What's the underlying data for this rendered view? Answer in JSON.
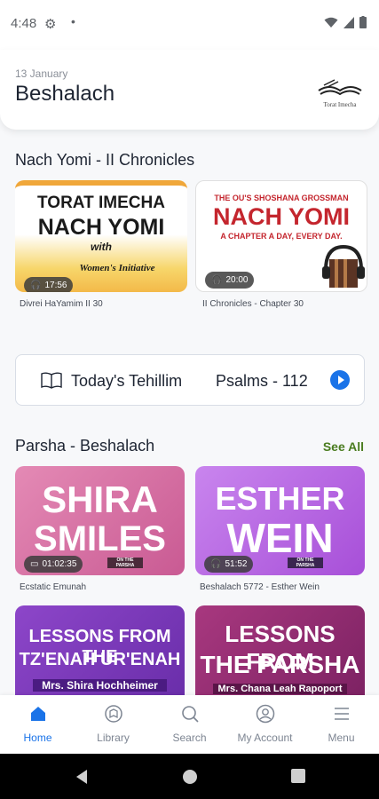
{
  "status": {
    "time": "4:48"
  },
  "header": {
    "date": "13 January",
    "title": "Beshalach",
    "logo_text": "Torat Imecha"
  },
  "nach": {
    "title": "Nach Yomi - II Chronicles",
    "cards": [
      {
        "line1": "TORAT IMECHA",
        "line2": "NACH YOMI",
        "line3": "with",
        "line4": "Women's Initiative",
        "duration": "17:56",
        "caption": "Divrei HaYamim II 30"
      },
      {
        "line1": "THE OU'S SHOSHANA GROSSMAN",
        "line2": "NACH YOMI",
        "line3": "A CHAPTER A DAY, EVERY DAY.",
        "duration": "20:00",
        "caption": "II Chronicles - Chapter 30"
      }
    ]
  },
  "tehillim": {
    "label": "Today's Tehillim",
    "value": "Psalms - 112"
  },
  "parsha": {
    "title": "Parsha - Beshalach",
    "see_all": "See All",
    "cards": [
      {
        "line1": "SHIRA",
        "line2": "SMILES",
        "tag": "ON THE PARSHA",
        "duration": "01:02:35",
        "caption": "Ecstatic Emunah"
      },
      {
        "line1": "ESTHER",
        "line2": "WEIN",
        "tag": "ON THE PARSHA",
        "duration": "51:52",
        "caption": "Beshalach 5772 - Esther Wein"
      },
      {
        "line1": "LESSONS FROM THE",
        "line2": "TZ'ENAH UR'ENAH",
        "line3": "Mrs. Shira Hochheimer"
      },
      {
        "line1": "LESSONS FROM",
        "line2": "THE PARSHA",
        "line3": "Mrs. Chana Leah Rapoport"
      }
    ]
  },
  "nav": {
    "home": "Home",
    "library": "Library",
    "search": "Search",
    "account": "My Account",
    "menu": "Menu"
  },
  "colors": {
    "accent": "#1a73e8",
    "see_all": "#4a7c1f",
    "card_pink": "#d86ba2",
    "card_purple": "#b45de0"
  }
}
